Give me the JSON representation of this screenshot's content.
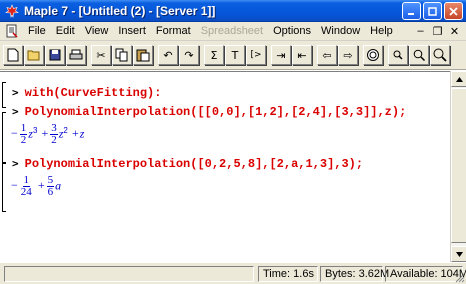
{
  "window": {
    "title": "Maple 7 - [Untitled (2) - [Server 1]]"
  },
  "menu": {
    "items": [
      "File",
      "Edit",
      "View",
      "Insert",
      "Format",
      "Spreadsheet",
      "Options",
      "Window",
      "Help"
    ],
    "disabled": [
      "Spreadsheet"
    ]
  },
  "toolbar": {
    "buttons": [
      {
        "name": "new-icon",
        "glyph": "🗋"
      },
      {
        "name": "open-icon",
        "glyph": "📂"
      },
      {
        "name": "save-icon",
        "glyph": "💾"
      },
      {
        "name": "print-icon",
        "glyph": "🖶"
      },
      {
        "name": "cut-icon",
        "glyph": "✂"
      },
      {
        "name": "copy-icon",
        "glyph": "⎘"
      },
      {
        "name": "paste-icon",
        "glyph": "📋"
      },
      {
        "name": "undo-icon",
        "glyph": "↶"
      },
      {
        "name": "redo-icon",
        "glyph": "↷"
      },
      {
        "name": "sigma-icon",
        "glyph": "Σ"
      },
      {
        "name": "text-icon",
        "glyph": "T"
      },
      {
        "name": "prompt-icon",
        "glyph": "[>"
      },
      {
        "name": "indent-icon",
        "glyph": "⇥"
      },
      {
        "name": "outdent-icon",
        "glyph": "⇤"
      },
      {
        "name": "back-arrow-icon",
        "glyph": "⇦"
      },
      {
        "name": "forward-arrow-icon",
        "glyph": "⇨"
      },
      {
        "name": "stop-icon",
        "glyph": "⊘"
      },
      {
        "name": "zoom-small-icon",
        "glyph": "🔍"
      },
      {
        "name": "zoom-medium-icon",
        "glyph": "🔍"
      },
      {
        "name": "zoom-large-icon",
        "glyph": "🔍"
      }
    ]
  },
  "worksheet": {
    "prompt": ">",
    "cmd1": "with(CurveFitting):",
    "cmd2": "PolynomialInterpolation([[0,0],[1,2],[2,4],[3,3]],z);",
    "out1": {
      "minus": "−",
      "f1_num": "1",
      "f1_den": "2",
      "t1_var": "z",
      "t1_exp": "3",
      "plus1": "+",
      "f2_num": "3",
      "f2_den": "2",
      "t2_var": "z",
      "t2_exp": "2",
      "plus2": "+",
      "t3": "z"
    },
    "cmd3": "PolynomialInterpolation([0,2,5,8],[2,a,1,3],3);",
    "out2": {
      "minus": "−",
      "f1_num": "1",
      "f1_den": "24",
      "plus": "+",
      "f2_num": "5",
      "f2_den": "6",
      "t2_var": "a"
    }
  },
  "status": {
    "time": "Time: 1.6s",
    "bytes": "Bytes: 3.62M",
    "available": "Available: 104M"
  }
}
